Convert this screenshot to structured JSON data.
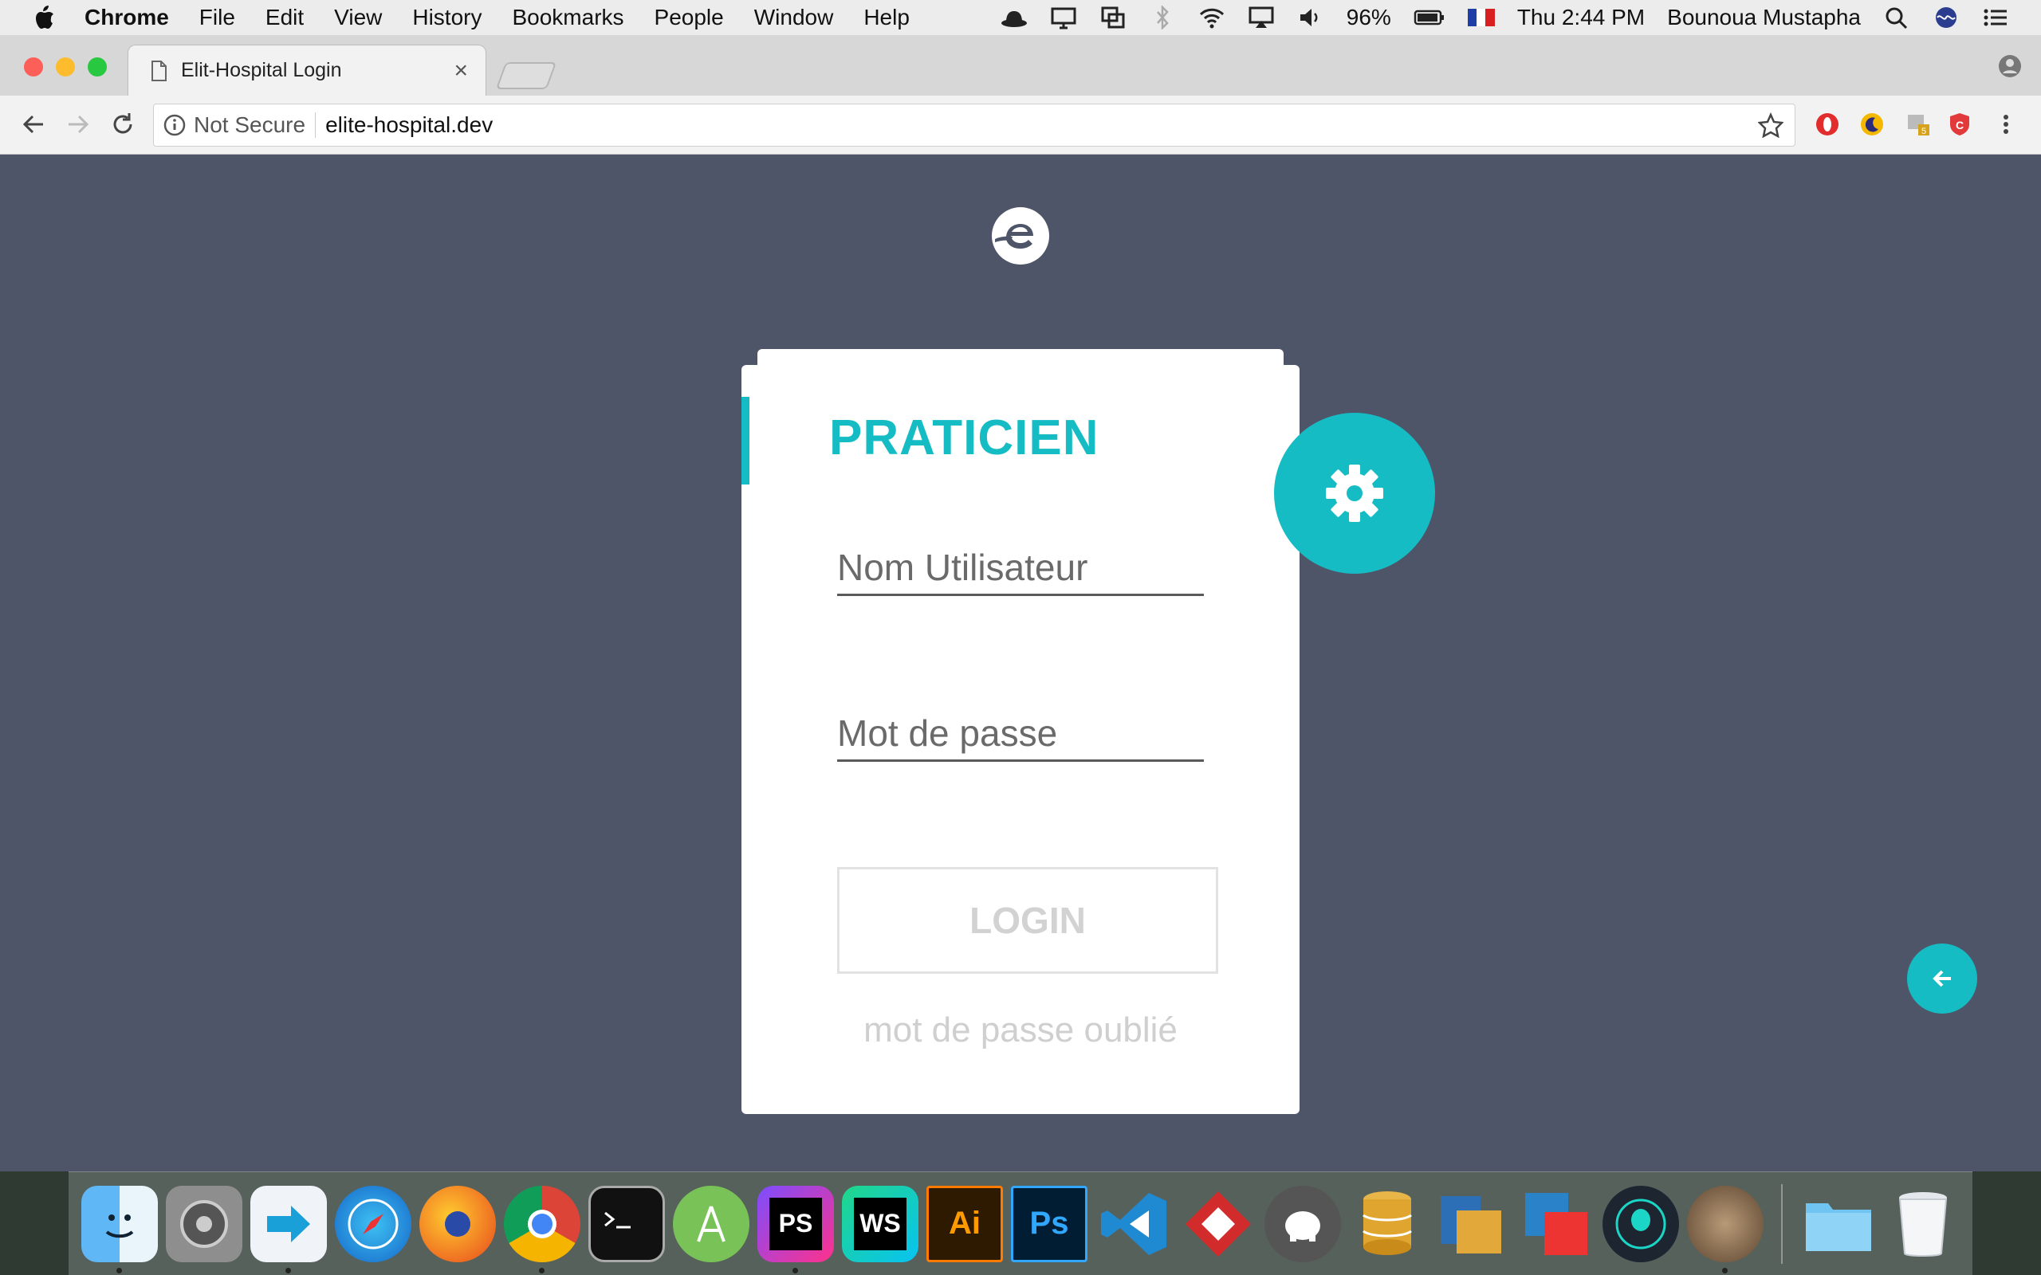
{
  "menubar": {
    "app": "Chrome",
    "items": [
      "File",
      "Edit",
      "View",
      "History",
      "Bookmarks",
      "People",
      "Window",
      "Help"
    ],
    "battery": "96%",
    "clock": "Thu 2:44 PM",
    "user": "Bounoua Mustapha"
  },
  "browser": {
    "tab_title": "Elit-Hospital Login",
    "tab_close": "×",
    "security_label": "Not Secure",
    "url": "elite-hospital.dev"
  },
  "login": {
    "title": "PRATICIEN",
    "username_placeholder": "Nom Utilisateur",
    "password_placeholder": "Mot de passe",
    "login_button": "LOGIN",
    "forgot_link": "mot de passe oublié"
  },
  "colors": {
    "accent": "#16bcc4",
    "page_background": "#4f5568"
  },
  "dock": {
    "icons": [
      "finder-icon",
      "system-preferences-icon",
      "migration-icon",
      "safari-icon",
      "firefox-icon",
      "chrome-icon",
      "terminal-icon",
      "android-studio-icon",
      "phpstorm-icon",
      "webstorm-icon",
      "illustrator-icon",
      "photoshop-icon",
      "visual-studio-code-icon",
      "git-client-icon",
      "sequel-pro-icon",
      "sequel-db-icon",
      "filezilla-icon",
      "vmware-icon",
      "gitkraken-icon",
      "armadillo-icon",
      "folder-icon",
      "trash-icon"
    ],
    "labels": {
      "phpstorm": "PS",
      "webstorm": "WS",
      "illustrator": "Ai",
      "photoshop": "Ps"
    }
  }
}
